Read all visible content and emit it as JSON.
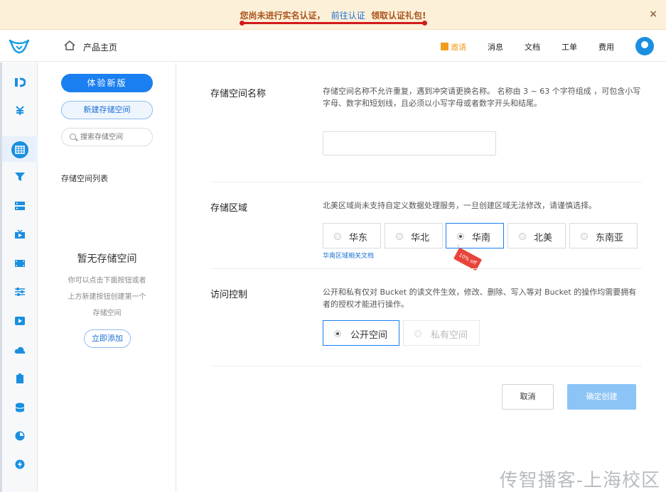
{
  "notice": {
    "text": "您尚未进行实名认证，",
    "link": "前往认证",
    "suffix": "领取认证礼包!",
    "close": "×"
  },
  "header": {
    "home_label": "产品主页",
    "nav": {
      "invite": "邀请",
      "messages": "消息",
      "docs": "文档",
      "tickets": "工单",
      "billing": "费用"
    }
  },
  "sidebar": {
    "new_version_button": "体验新版",
    "create_bucket_button": "新建存储空间",
    "search_placeholder": "搜索存储空间",
    "list_title": "存储空间列表",
    "empty_title": "暂无存储空间",
    "empty_desc": "你可以点击下面按钮或者上方新建按钮创建第一个存储空间",
    "add_button": "立即添加"
  },
  "form": {
    "name": {
      "label": "存储空间名称",
      "desc": "存储空间名称不允许重复，遇到冲突请更换名称。 名称由 3 ~ 63 个字符组成 ，可包含小写字母、数字和短划线，且必须以小写字母或者数字开头和结尾。",
      "value": ""
    },
    "region": {
      "label": "存储区域",
      "desc": "北美区域尚未支持自定义数据处理服务，一旦创建区域无法修改，请谨慎选择。",
      "options": [
        "华东",
        "华北",
        "华南",
        "北美",
        "东南亚"
      ],
      "selected": "华南",
      "doc_link": "华南区域相关文档",
      "discount_tag": "10% off"
    },
    "access": {
      "label": "访问控制",
      "desc": "公开和私有仅对 Bucket 的读文件生效，修改、删除、写入等对 Bucket 的操作均需要拥有者的授权才能进行操作。",
      "options": [
        "公开空间",
        "私有空间"
      ],
      "selected": "公开空间"
    },
    "cancel_button": "取消",
    "confirm_button": "确定创建"
  },
  "watermark": "传智播客-上海校区",
  "colors": {
    "primary": "#1a7ff0",
    "notice_bg": "#fdf0d8",
    "notice_text": "#a8541c",
    "confirm_disabled": "#8cc4f6",
    "discount": "#e8443a"
  }
}
